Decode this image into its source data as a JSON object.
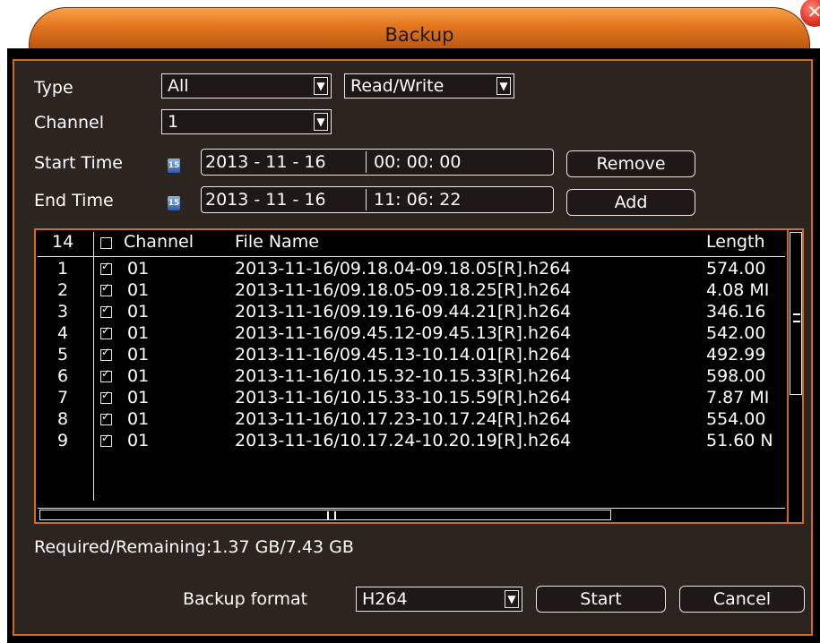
{
  "window": {
    "title": "Backup",
    "close_icon": "close-icon"
  },
  "filters": {
    "type_label": "Type",
    "type_value": "All",
    "mode_value": "Read/Write",
    "channel_label": "Channel",
    "channel_value": "1",
    "start_time_label": "Start Time",
    "start_date": "2013 - 11 - 16",
    "start_time": "00: 00: 00",
    "end_time_label": "End Time",
    "end_date": "2013 - 11 - 16",
    "end_time": "11: 06: 22",
    "remove_label": "Remove",
    "add_label": "Add"
  },
  "file_list": {
    "count": "14",
    "columns": {
      "channel": "Channel",
      "file_name": "File Name",
      "length": "Length"
    },
    "rows": [
      {
        "num": "1",
        "checked": true,
        "channel": "01",
        "file": "2013-11-16/09.18.04-09.18.05[R].h264",
        "length": "574.00"
      },
      {
        "num": "2",
        "checked": true,
        "channel": "01",
        "file": "2013-11-16/09.18.05-09.18.25[R].h264",
        "length": "4.08 MI"
      },
      {
        "num": "3",
        "checked": true,
        "channel": "01",
        "file": "2013-11-16/09.19.16-09.44.21[R].h264",
        "length": "346.16"
      },
      {
        "num": "4",
        "checked": true,
        "channel": "01",
        "file": "2013-11-16/09.45.12-09.45.13[R].h264",
        "length": "542.00"
      },
      {
        "num": "5",
        "checked": true,
        "channel": "01",
        "file": "2013-11-16/09.45.13-10.14.01[R].h264",
        "length": "492.99"
      },
      {
        "num": "6",
        "checked": true,
        "channel": "01",
        "file": "2013-11-16/10.15.32-10.15.33[R].h264",
        "length": "598.00"
      },
      {
        "num": "7",
        "checked": true,
        "channel": "01",
        "file": "2013-11-16/10.15.33-10.15.59[R].h264",
        "length": "7.87 MI"
      },
      {
        "num": "8",
        "checked": true,
        "channel": "01",
        "file": "2013-11-16/10.17.23-10.17.24[R].h264",
        "length": "554.00"
      },
      {
        "num": "9",
        "checked": true,
        "channel": "01",
        "file": "2013-11-16/10.17.24-10.20.19[R].h264",
        "length": "51.60 N"
      }
    ]
  },
  "status": {
    "required_remaining": "Required/Remaining:1.37 GB/7.43 GB"
  },
  "footer": {
    "format_label": "Backup format",
    "format_value": "H264",
    "start_label": "Start",
    "cancel_label": "Cancel"
  },
  "colors": {
    "accent": "#d26a1e",
    "panel": "#2b241f",
    "text": "#ffffff"
  }
}
